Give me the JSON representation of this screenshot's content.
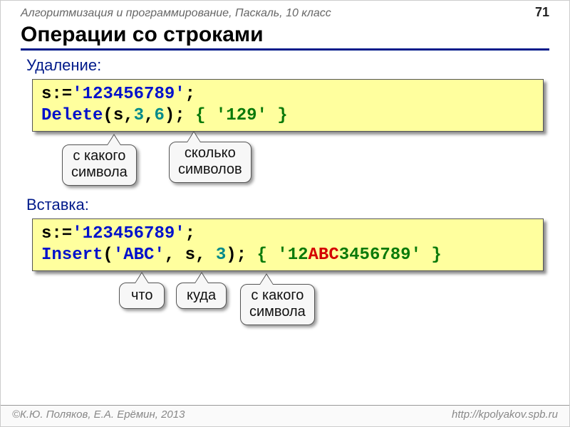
{
  "header": {
    "course": "Алгоритмизация и программирование, Паскаль, 10 класс",
    "page": "71"
  },
  "title": "Операции со строками",
  "delete": {
    "label": "Удаление:",
    "l1_var": "s",
    "l1_assign": ":=",
    "l1_val": "'123456789'",
    "l1_semi": ";",
    "l2_fn": "Delete",
    "l2_open": "(",
    "l2_arg1": "s",
    "l2_c1": ",",
    "l2_arg2": "3",
    "l2_c2": ",",
    "l2_arg3": "6",
    "l2_close": ");",
    "l2_comment": "{ '129' }",
    "callout_from": "с какого\nсимвола",
    "callout_count": "сколько\nсимволов"
  },
  "insert": {
    "label": "Вставка:",
    "l1_var": "s",
    "l1_assign": ":=",
    "l1_val": "'123456789'",
    "l1_semi": ";",
    "l2_fn": "Insert",
    "l2_open": "(",
    "l2_arg1": "'ABC'",
    "l2_c1": ",",
    "l2_arg2": " s",
    "l2_c2": ",",
    "l2_arg3": " 3",
    "l2_close": ");",
    "l2_comment_open": "{ '",
    "l2_comment_a": "12",
    "l2_comment_b": "ABC",
    "l2_comment_c": "3456789",
    "l2_comment_close": "' }",
    "callout_what": "что",
    "callout_where": "куда",
    "callout_from": "с какого\nсимвола"
  },
  "footer": {
    "left": "©К.Ю. Поляков, Е.А. Ерёмин, 2013",
    "right": "http://kpolyakov.spb.ru"
  }
}
